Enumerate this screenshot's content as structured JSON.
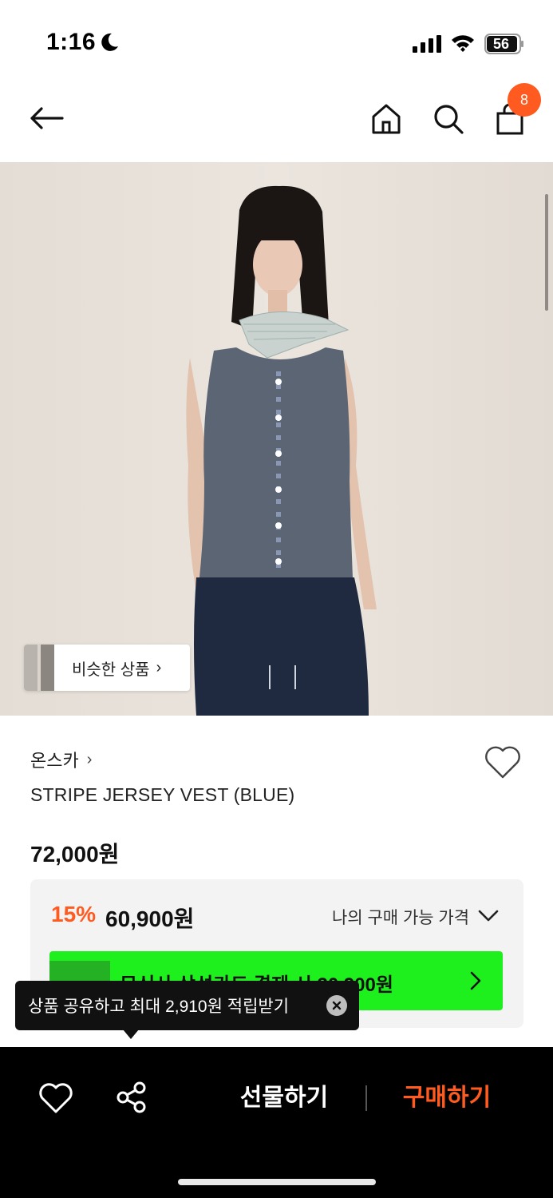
{
  "status_bar": {
    "time": "1:16",
    "battery": "56",
    "icons": [
      "moon-icon",
      "signal-icon",
      "wifi-icon",
      "battery-icon"
    ]
  },
  "nav": {
    "cart_count": "8",
    "icons": [
      "back-arrow-icon",
      "home-icon",
      "search-icon",
      "cart-icon"
    ]
  },
  "product": {
    "similar_label": "비슷한 상품",
    "brand": "온스카",
    "title": "STRIPE JERSEY VEST (BLUE)",
    "original_price": "72,000원",
    "discount_rate": "15%",
    "discount_price": "60,900원",
    "my_price_label": "나의 구매 가능 가격",
    "card_promo": "무신사 삼성카드 결제 시 30,900원"
  },
  "tooltip": {
    "text": "상품 공유하고 최대 2,910원 적립받기"
  },
  "bottom_bar": {
    "gift_label": "선물하기",
    "buy_label": "구매하기"
  },
  "colors": {
    "accent": "#ff5a1f",
    "promo_green": "#1ef01e",
    "bottom_bar": "#000000"
  }
}
